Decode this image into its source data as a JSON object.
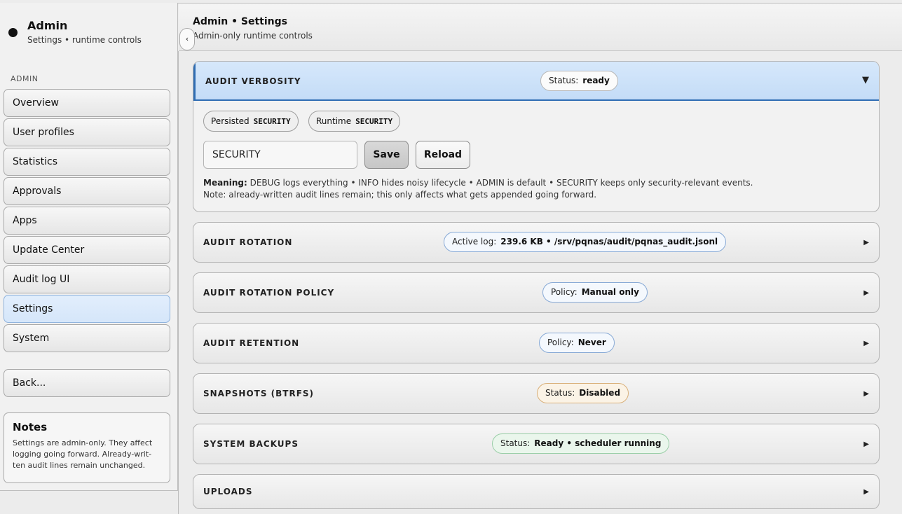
{
  "sidebar": {
    "brand_title": "Admin",
    "brand_subtitle": "Settings • runtime controls",
    "section_label": "ADMIN",
    "items": [
      {
        "label": "Overview"
      },
      {
        "label": "User profiles"
      },
      {
        "label": "Statistics"
      },
      {
        "label": "Approvals"
      },
      {
        "label": "Apps"
      },
      {
        "label": "Update Center"
      },
      {
        "label": "Audit log UI"
      },
      {
        "label": "Settings",
        "active": true
      },
      {
        "label": "System"
      }
    ],
    "back_label": "Back...",
    "notes": {
      "title": "Notes",
      "text": "Settings are admin-only. They affect logging going forward. Already-writ-ten audit lines remain unchanged."
    }
  },
  "header": {
    "title": "Admin • Settings",
    "subtitle": "Admin-only runtime controls",
    "collapse_glyph": "‹"
  },
  "panels": {
    "audit_verbosity": {
      "title": "AUDIT VERBOSITY",
      "pill_key": "Status:",
      "pill_value": "ready",
      "chevron": "▼",
      "persisted_key": "Persisted",
      "persisted_value": "SECURITY",
      "runtime_key": "Runtime",
      "runtime_value": "SECURITY",
      "input_value": "SECURITY",
      "save_label": "Save",
      "reload_label": "Reload",
      "meaning_label": "Meaning:",
      "meaning_text": "DEBUG logs everything • INFO hides noisy lifecycle • ADMIN is default • SECURITY keeps only security-relevant events.",
      "note_text": "Note: already-written audit lines remain; this only affects what gets appended going forward."
    },
    "audit_rotation": {
      "title": "AUDIT ROTATION",
      "pill_key": "Active log:",
      "pill_value": "239.6 KB • /srv/pqnas/audit/pqnas_audit.jsonl",
      "chevron": "▶"
    },
    "audit_rotation_policy": {
      "title": "AUDIT ROTATION POLICY",
      "pill_key": "Policy:",
      "pill_value": "Manual only",
      "chevron": "▶"
    },
    "audit_retention": {
      "title": "AUDIT RETENTION",
      "pill_key": "Policy:",
      "pill_value": "Never",
      "chevron": "▶"
    },
    "snapshots": {
      "title": "SNAPSHOTS (BTRFS)",
      "pill_key": "Status:",
      "pill_value": "Disabled",
      "chevron": "▶"
    },
    "system_backups": {
      "title": "SYSTEM BACKUPS",
      "pill_key": "Status:",
      "pill_value": "Ready • scheduler running",
      "chevron": "▶"
    },
    "uploads": {
      "title": "UPLOADS",
      "chevron": "▶"
    }
  },
  "colors": {
    "accent": "#2f6db3",
    "active_nav": "#d5e6fa",
    "warn_pill": "#fbf3e6",
    "ok_pill": "#eaf6ec"
  },
  "icons": {
    "brand": "dot-icon",
    "collapse": "chevron-left-icon",
    "expanded": "caret-down-icon",
    "collapsed": "caret-right-icon"
  }
}
